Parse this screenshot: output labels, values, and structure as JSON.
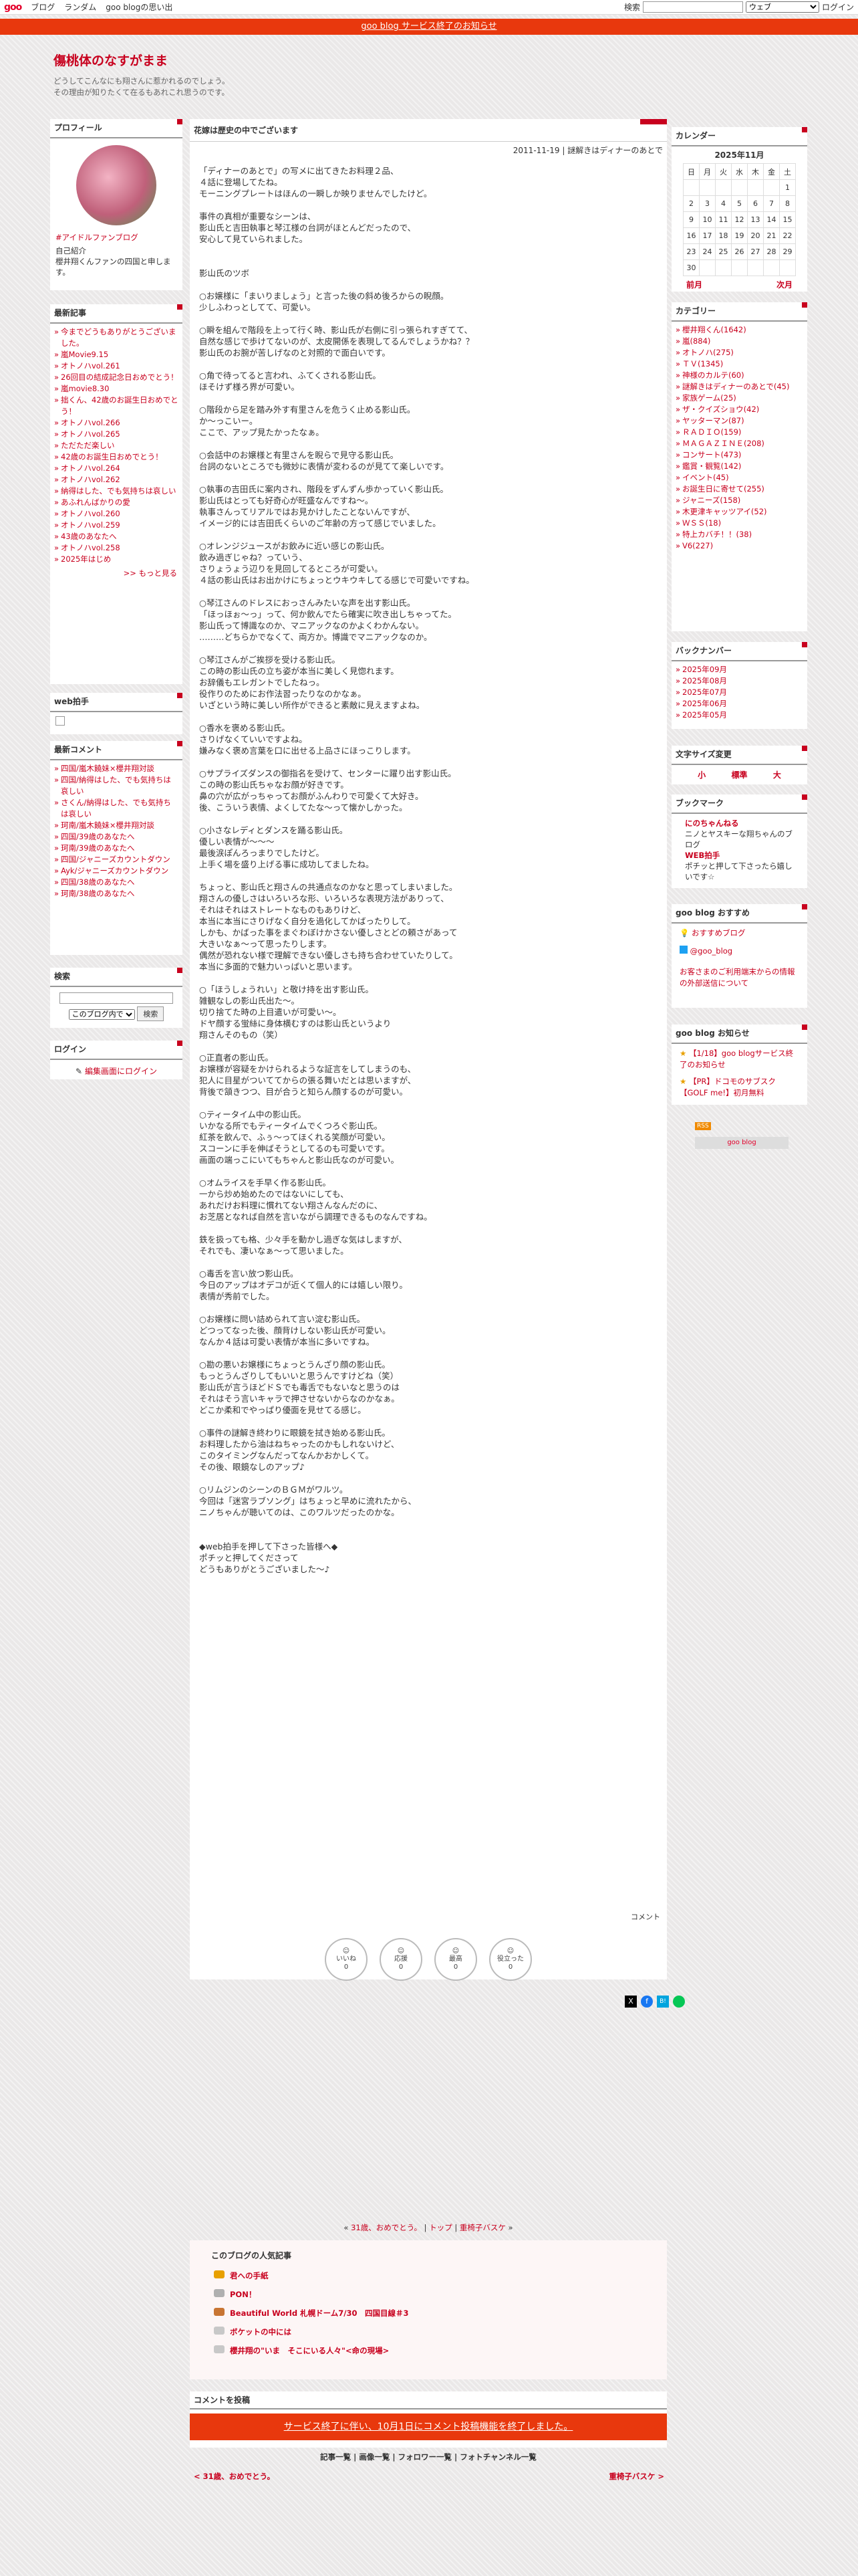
{
  "gnav": {
    "logo": "goo",
    "links": [
      "ブログ",
      "ランダム",
      "goo blogの思い出"
    ],
    "search_label": "検索",
    "search_scope": "ウェブ",
    "login": "ログイン"
  },
  "notice": "goo blog サービス終了のお知らせ",
  "blog": {
    "title": "傷桃体のなすがまま",
    "desc1": "どうしてこんなにも翔さんに惹かれるのでしょう。",
    "desc2": "その理由が知りたくて在るもあれこれ思うのです。"
  },
  "profile": {
    "heading": "プロフィール",
    "link": "#アイドルファンブログ",
    "l1": "自己紹介",
    "l2": "櫻井翔くんファンの四国と申します。"
  },
  "recent": {
    "heading": "最新記事",
    "items": [
      "今までどうもありがとうございました。",
      "嵐Movie9.15",
      "オトノハvol.261",
      "26回目の結成記念日おめでとう！",
      "嵐movie8.30",
      "拙くん、42歳のお誕生日おめでとう！",
      "オトノハvol.266",
      "オトノハvol.265",
      "ただただ楽しい",
      "42歳のお誕生日おめでとう！",
      "オトノハvol.264",
      "オトノハvol.262",
      "納得はした、でも気持ちは哀しい",
      "あふれんばかりの愛",
      "オトノハvol.260",
      "オトノハvol.259",
      "43歳のあなたへ",
      "オトノハvol.258",
      "2025年はじめ"
    ],
    "more": ">> もっと見る"
  },
  "webclap": {
    "heading": "web拍手"
  },
  "comments": {
    "heading": "最新コメント",
    "items": [
      "四国/嵐木饒妹×櫻井翔対談",
      "四国/納得はした、でも気持ちは哀しい",
      "さくん/納得はした、でも気持ちは哀しい",
      "珂南/嵐木饒妹×櫻井翔対談",
      "四国/39歳のあなたへ",
      "珂南/39歳のあなたへ",
      "四国/ジャニーズカウントダウン",
      "Ayk/ジャニーズカウントダウン",
      "四国/38歳のあなたへ",
      "珂南/38歳のあなたへ"
    ]
  },
  "search": {
    "heading": "検索",
    "scope": "このブログ内で",
    "button": "検索"
  },
  "login": {
    "heading": "ログイン",
    "link": "編集画面にログイン"
  },
  "calendar": {
    "heading": "カレンダー",
    "month": "2025年11月",
    "dows": [
      "日",
      "月",
      "火",
      "水",
      "木",
      "金",
      "土"
    ],
    "rows": [
      [
        "",
        "",
        "",
        "",
        "",
        "",
        "1"
      ],
      [
        "2",
        "3",
        "4",
        "5",
        "6",
        "7",
        "8"
      ],
      [
        "9",
        "10",
        "11",
        "12",
        "13",
        "14",
        "15"
      ],
      [
        "16",
        "17",
        "18",
        "19",
        "20",
        "21",
        "22"
      ],
      [
        "23",
        "24",
        "25",
        "26",
        "27",
        "28",
        "29"
      ],
      [
        "30",
        "",
        "",
        "",
        "",
        "",
        ""
      ]
    ],
    "prev": "前月",
    "next": "次月"
  },
  "categories": {
    "heading": "カテゴリー",
    "items": [
      "櫻井翔くん(1642)",
      "嵐(884)",
      "オトノハ(275)",
      "ＴＶ(1345)",
      "神様のカルテ(60)",
      "謎解きはディナーのあとで(45)",
      "家族ゲーム(25)",
      "ザ・クイズショウ(42)",
      "ヤッターマン(87)",
      "ＲＡＤＩＯ(159)",
      "ＭＡＧＡＺＩＮＥ(208)",
      "コンサート(473)",
      "鑑賞・観覧(142)",
      "イベント(45)",
      "お誕生日に寄せて(255)",
      "ジャニーズ(158)",
      "木更津キャッツアイ(52)",
      "ＷＳＳ(18)",
      "特上カバチ！！(38)",
      "V6(227)"
    ]
  },
  "backnumber": {
    "heading": "バックナンバー",
    "items": [
      "2025年09月",
      "2025年08月",
      "2025年07月",
      "2025年06月",
      "2025年05月"
    ]
  },
  "fontsize": {
    "heading": "文字サイズ変更",
    "small": "小",
    "mid": "標準",
    "large": "大"
  },
  "bookmarks": {
    "heading": "ブックマーク",
    "b1": "にのちゃんねる",
    "b1d": "ニノとヤスキーな翔ちゃんのブログ",
    "b2": "WEB拍手",
    "b2d": "ポチッと押して下さったら嬉しいです☆"
  },
  "goo_reco": {
    "heading": "goo blog おすすめ",
    "l1": "おすすめブログ",
    "l2": "@goo_blog",
    "l3": "お客さまのご利用端末からの情報の外部送信について"
  },
  "goo_info": {
    "heading": "goo blog お知らせ",
    "l1": "【1/18】goo blogサービス終了のお知らせ",
    "l2": "【PR】ドコモのサブスク【GOLF me!】初月無料"
  },
  "rss": "RSS",
  "goo_badge": "goo blog",
  "post": {
    "title": "花嫁は歴史の中でございます",
    "meta": "2011-11-19 | 謎解きはディナーのあとで",
    "comment_label": "コメント",
    "body": "「ディナーのあとで」の写メに出てきたお料理２品、\n４話に登場してたね。\nモーニングプレートはほんの一瞬しか映りませんでしたけど。\n\n事件の真相が重要なシーンは、\n影山氏と吉田執事と琴江様の台詞がほとんどだったので、\n安心して見ていられました。\n\n\n影山氏のツボ\n\n○お嬢様に「まいりましょう」と言った後の斜め後ろからの睨顔。\n少しふわっとしてて、可愛い。\n\n○瞬を組んで階段を上って行く時、影山氏が右側に引っ張られすぎてて、\n自然な感じで歩けてないのが、太皮開係を表現してるんでしょうかね？？\n影山氏のお腕が苦しげなのと対照的で面白いです。\n\n○角で待ってると言われ、ふてくされる影山氏。\nほそけず様ろ界が可愛い。\n\n○階段から足を踏み外す有里さんを危うく止める影山氏。\nか～っこいー。\nここで、アップ見たかったなぁ。\n\n○会話中のお嬢様と有里さんを睨らで見守る影山氏。\n台詞のないところでも微妙に表情が変わるのが見てて楽しいです。\n\n○執事の吉田氏に案内され、階段をずんずん歩かっていく影山氏。\n影山氏はとっても好奇心が旺盛なんですね～。\n執事さんってリアルではお見かけしたことないんですが、\nイメージ的には吉田氏くらいのご年齢の方って感じでいました。\n\n○オレンジジュースがお飲みに近い感じの影山氏。\n飲み過ぎじゃね？っていう、\nさりょうょう辺りを見回してるところが可愛い。\n４話の影山氏はお出かけにちょっとウキウキしてる感じで可愛いですね。\n\n○琴江さんのドレスにおっさんみたいな声を出す影山氏。\n「ほっほぉ～っ」って、何か飲んでたら確実に吹き出しちゃってた。\n影山氏って博識なのか、マニアックなのかよくわかんない。\n………どちらかでなくて、両方か。博識でマニアックなのか。\n\n○琴江さんがご挨拶を受ける影山氏。\nこの時の影山氏の立ち姿が本当に美しく見惚れます。\nお辞儀もエレガントでしたねっ。\n役作りのためにお作法習ったりなのかなぁ。\nいざという時に美しい所作ができると素敵に見えますよね。\n\n○香水を褒める影山氏。\nさりげなくていいですよね。\n嫌みなく褒め言葉を口に出せる上品さにほっこりします。\n\n○サプライズダンスの御指名を受けて、センターに躍り出す影山氏。\nこの時の影山氏ちゃなお顔が好きです。\n鼻の穴が広がっちゃってお顔がふんわりで可愛くて大好き。\n後、こういう表情、よくしてたな～って懐かしかった。\n\n○小さなレディとダンスを踊る影山氏。\n優しい表情が～～～\n最後涙ぽんろっまりでしたけど。\n上手く場を盛り上げる事に成功してましたね。\n\nちょっと、影山氏と翔さんの共通点なのかなと思ってしまいました。\n翔さんの優しさはいろいろな形、いろいろな表現方法がありって、\nそれはそれはストレートなものもありけど、\n本当に本当にさりげなく自分を過化してかばったりして。\nしかも、かばった事をまぐわぼけかさない優しさとどの頼さがあって\n大きいなぁ～って思ったりします。\n偶然が恐れない様で理解できない優しさも持ち合わせていたりして。\n本当に多面的で魅力いっぱいと思います。\n\n○「ほうしょうれい」と敬け持を出す影山氏。\n雑観なしの影山氏出た～。\n切り捨てた時の上目遣いが可愛い～。\nドヤ顔する蛍絲に身体横むすのは影山氏というより\n翔さんそのもの（笑）\n\n○正直者の影山氏。\nお嬢様が容疑をかけられるような証言をしてしまうのも、\n犯人に目星がついててからの張る舞いだとは思いますが、\n背後で頷きつつ、目が合うと知らん顔するのが可愛い。\n\n○ティータイム中の影山氏。\nいかなる所でもティータイムでくつろぐ影山氏。\n紅茶を飲んで、ふぅ～ってほくれる笑顔が可愛い。\nスコーンに手を伸ばそうとしてるのも可愛いです。\n画面の端っこにいてもちゃんと影山氏なのが可愛い。\n\n○オムライスを手早く作る影山氏。\n一から炒め始めたのではないにしても、\nあれだけお料理に慣れてない翔さんなんだのに、\nお芝居となれば自然を言いながら調理できるものなんですね。\n\n鉄を扱っても格、少々手を動かし過ぎな気はしますが、\nそれでも、凄いなぁ～って思いました。\n\n○毒舌を言い放つ影山氏。\n今日のアップはオデコが近くて個人的には嬉しい限り。\n表情が秀前でした。\n\n○お嬢様に問い詰められて言い淀む影山氏。\nどつってなった後、顔背けしない影山氏が可愛い。\nなんか４話は可愛い表情が本当に多いですね。\n\n○勘の悪いお嬢様にちょっとうんざり顔の影山氏。\nもっとうんざりしてもいいと思うんですけどね（笑）\n影山氏が言うほどドＳでも毒舌でもないなと思うのは\nそれはそう言いキャラで押させないからなのかなぁ。\nどこか柔和でやっぱり優面を見せてる感じ。\n\n○事件の謎解き終わりに眼鏡を拭き始める影山氏。\nお料理したから油はねちゃったのかもしれないけど、\nこのタイミングなんだってなんかおかしくて。\nその後、眼鏡なしのアップ♪\n\n○リムジンのシーンのＢＧＭがワルツ。\n今回は「迷宮ラブソング」はちょっと早めに流れたから、\nニノちゃんが聴いてのは、このワルツだったのかな。\n\n\n◆web拍手を押して下さった皆様へ◆\nポチッと押してくださって\nどうもありがとうございました～♪"
  },
  "reactions": [
    {
      "label": "いいね",
      "count": "0"
    },
    {
      "label": "応援",
      "count": "0"
    },
    {
      "label": "最高",
      "count": "0"
    },
    {
      "label": "役立った",
      "count": "0"
    }
  ],
  "post_nav": {
    "prev": "31歳、おめでとう。",
    "top": "トップ",
    "next": "重椅子バスケ"
  },
  "popular": {
    "heading": "このブログの人気記事",
    "items": [
      "君への手紙",
      "PON！",
      "Beautiful World 札幌ドーム7/30　四国目線＃3",
      "ボケットの中には",
      "櫻井翔の\"いま　そこにいる人々\"<命の現場>"
    ]
  },
  "comment_post": {
    "heading": "コメントを投稿",
    "notice": "サービス終了に伴い、10月1日にコメント投稿機能を終了しました。"
  },
  "bottom_links": "記事一覧 | 画像一覧 | フォロワー一覧 | フォトチャンネル一覧",
  "bottom_nav": {
    "prev": "< 31歳、おめでとう。",
    "next": "重椅子バスケ >"
  }
}
